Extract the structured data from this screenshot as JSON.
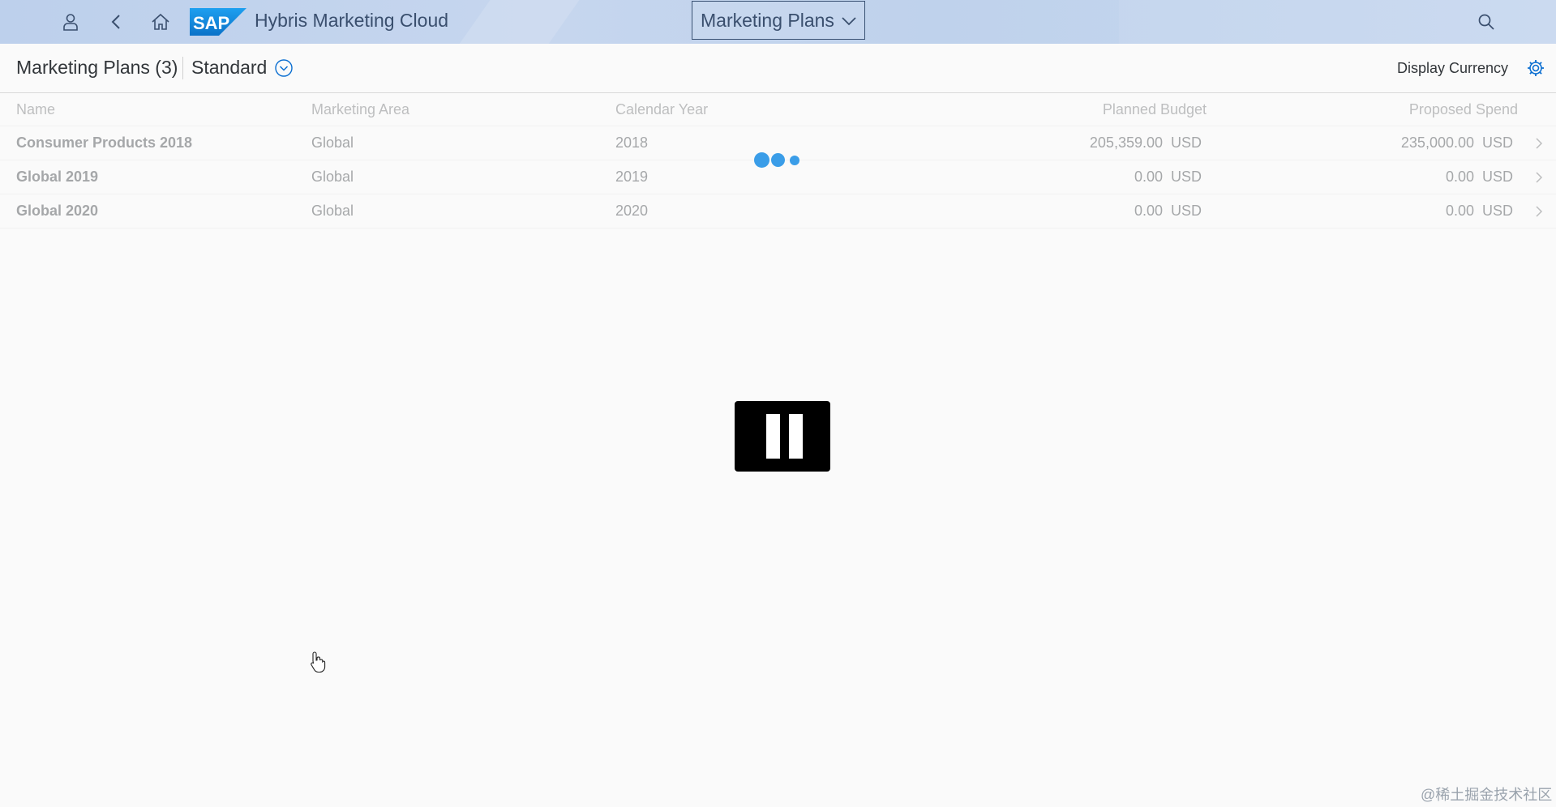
{
  "shell": {
    "app_title": "Hybris Marketing Cloud",
    "logo_text": "SAP",
    "nav_dropdown_label": "Marketing Plans",
    "icons": [
      "user-icon",
      "back-icon",
      "home-icon",
      "search-icon"
    ],
    "background_color": "#bdd0ec"
  },
  "page": {
    "title": "Marketing Plans (3)",
    "variant": "Standard",
    "display_currency_label": "Display Currency"
  },
  "table": {
    "columns": [
      "Name",
      "Marketing Area",
      "Calendar Year",
      "Planned Budget",
      "Proposed Spend"
    ],
    "rows": [
      {
        "name": "Consumer Products 2018",
        "area": "Global",
        "year": "2018",
        "budget": "205,359.00",
        "budget_cur": "USD",
        "spend": "235,000.00",
        "spend_cur": "USD"
      },
      {
        "name": "Global 2019",
        "area": "Global",
        "year": "2019",
        "budget": "0.00",
        "budget_cur": "USD",
        "spend": "0.00",
        "spend_cur": "USD"
      },
      {
        "name": "Global 2020",
        "area": "Global",
        "year": "2020",
        "budget": "0.00",
        "budget_cur": "USD",
        "spend": "0.00",
        "spend_cur": "USD"
      }
    ]
  },
  "busy_indicator": {
    "color": "#3a9de8"
  },
  "watermark": "@稀土掘金技术社区"
}
